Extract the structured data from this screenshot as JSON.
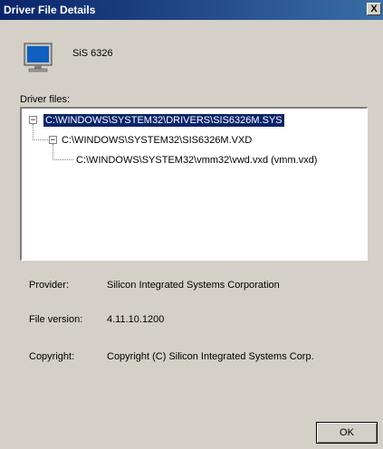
{
  "window": {
    "title": "Driver File Details",
    "close_label": "X"
  },
  "device": {
    "name": "SiS 6326",
    "icon": "monitor-icon"
  },
  "tree": {
    "label": "Driver files:",
    "items": [
      {
        "text": "C:\\WINDOWS\\SYSTEM32\\DRIVERS\\SIS6326M.SYS",
        "selected": true
      },
      {
        "text": "C:\\WINDOWS\\SYSTEM32\\SIS6326M.VXD",
        "selected": false
      },
      {
        "text": "C:\\WINDOWS\\SYSTEM32\\vmm32\\vwd.vxd (vmm.vxd)",
        "selected": false
      }
    ]
  },
  "info": {
    "provider_label": "Provider:",
    "provider_value": "Silicon Integrated Systems Corporation",
    "version_label": "File version:",
    "version_value": "4.11.10.1200",
    "copyright_label": "Copyright:",
    "copyright_value": "Copyright (C) Silicon Integrated Systems Corp."
  },
  "buttons": {
    "ok_label": "OK"
  }
}
